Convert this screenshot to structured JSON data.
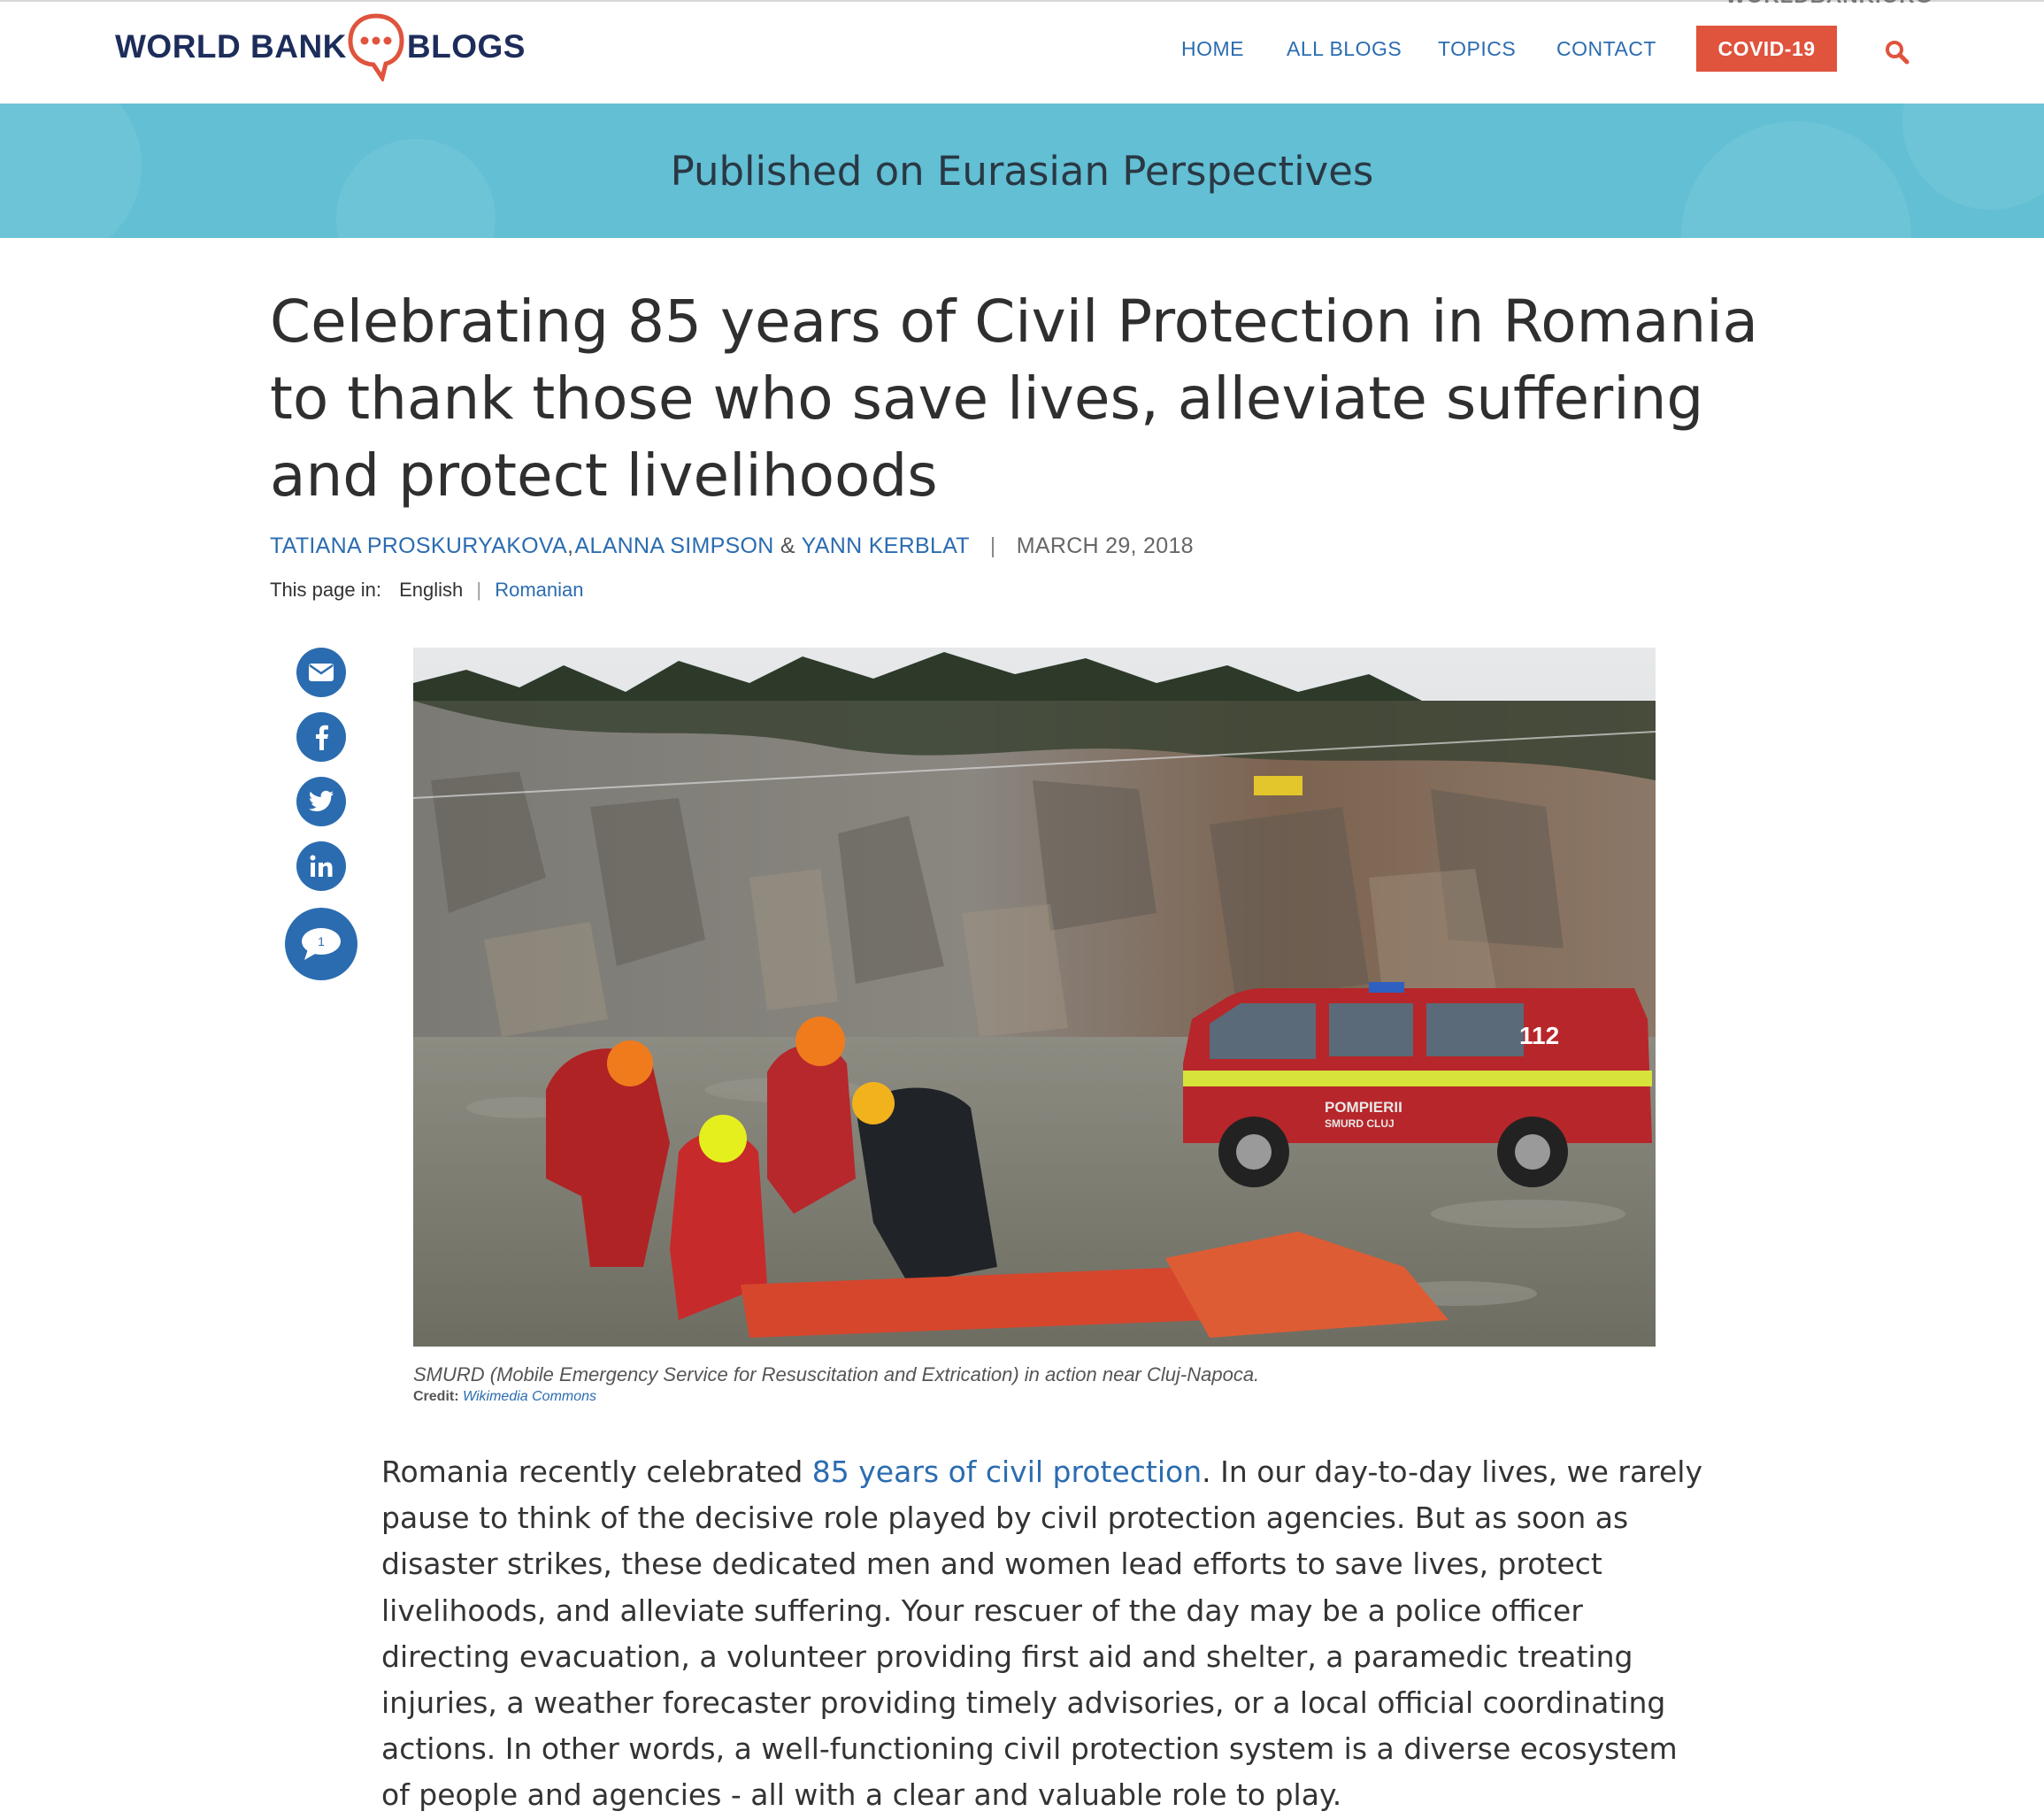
{
  "header": {
    "logo_left": "WORLD BANK",
    "logo_right": "BLOGS",
    "top_link": "WORLDBANK.ORG",
    "nav": [
      "HOME",
      "ALL BLOGS",
      "TOPICS",
      "CONTACT"
    ],
    "covid_button": "COVID-19"
  },
  "banner": {
    "text": "Published on Eurasian Perspectives"
  },
  "article": {
    "title": "Celebrating 85 years of Civil Protection in Romania to thank those who save lives, alleviate suffering and protect livelihoods",
    "authors": [
      "TATIANA PROSKURYAKOVA",
      "ALANNA SIMPSON",
      "YANN KERBLAT"
    ],
    "author_sep_1": ",",
    "author_sep_2": "&",
    "date_sep": "|",
    "date": "MARCH 29, 2018",
    "language_label": "This page in:",
    "language_current": "English",
    "language_sep": "|",
    "language_other": "Romanian",
    "share_icons": [
      "envelope-icon",
      "facebook-icon",
      "twitter-icon",
      "linkedin-icon",
      "comment-icon"
    ],
    "comment_count": "1",
    "image_text": {
      "vehicle_number": "112",
      "vehicle_label_1": "POMPIERII",
      "vehicle_label_2": "SMURD CLUJ"
    },
    "caption": "SMURD (Mobile Emergency Service for Resuscitation and Extrication) in action near Cluj-Napoca.",
    "credit_label": "Credit:",
    "credit_source": "Wikimedia Commons",
    "body_before_link": "Romania recently celebrated ",
    "body_link": "85 years of civil protection",
    "body_after_link": ". In our day-to-day lives, we rarely pause to think of the decisive role played by civil protection agencies. But as soon as disaster strikes, these dedicated men and women lead efforts to save lives, protect livelihoods, and alleviate suffering. Your rescuer of the day may be a police officer directing evacuation, a volunteer providing first aid and shelter, a paramedic treating injuries, a weather forecaster providing timely advisories, or a local official coordinating actions. In other words, a well-functioning civil protection system is a diverse ecosystem of people and agencies - all with a clear and valuable role to play."
  },
  "colors": {
    "link": "#2b6cb0",
    "covid": "#e0533d",
    "banner": "#62bfd4",
    "logo_text": "#1d2d5b",
    "logo_accent": "#e0533d"
  }
}
